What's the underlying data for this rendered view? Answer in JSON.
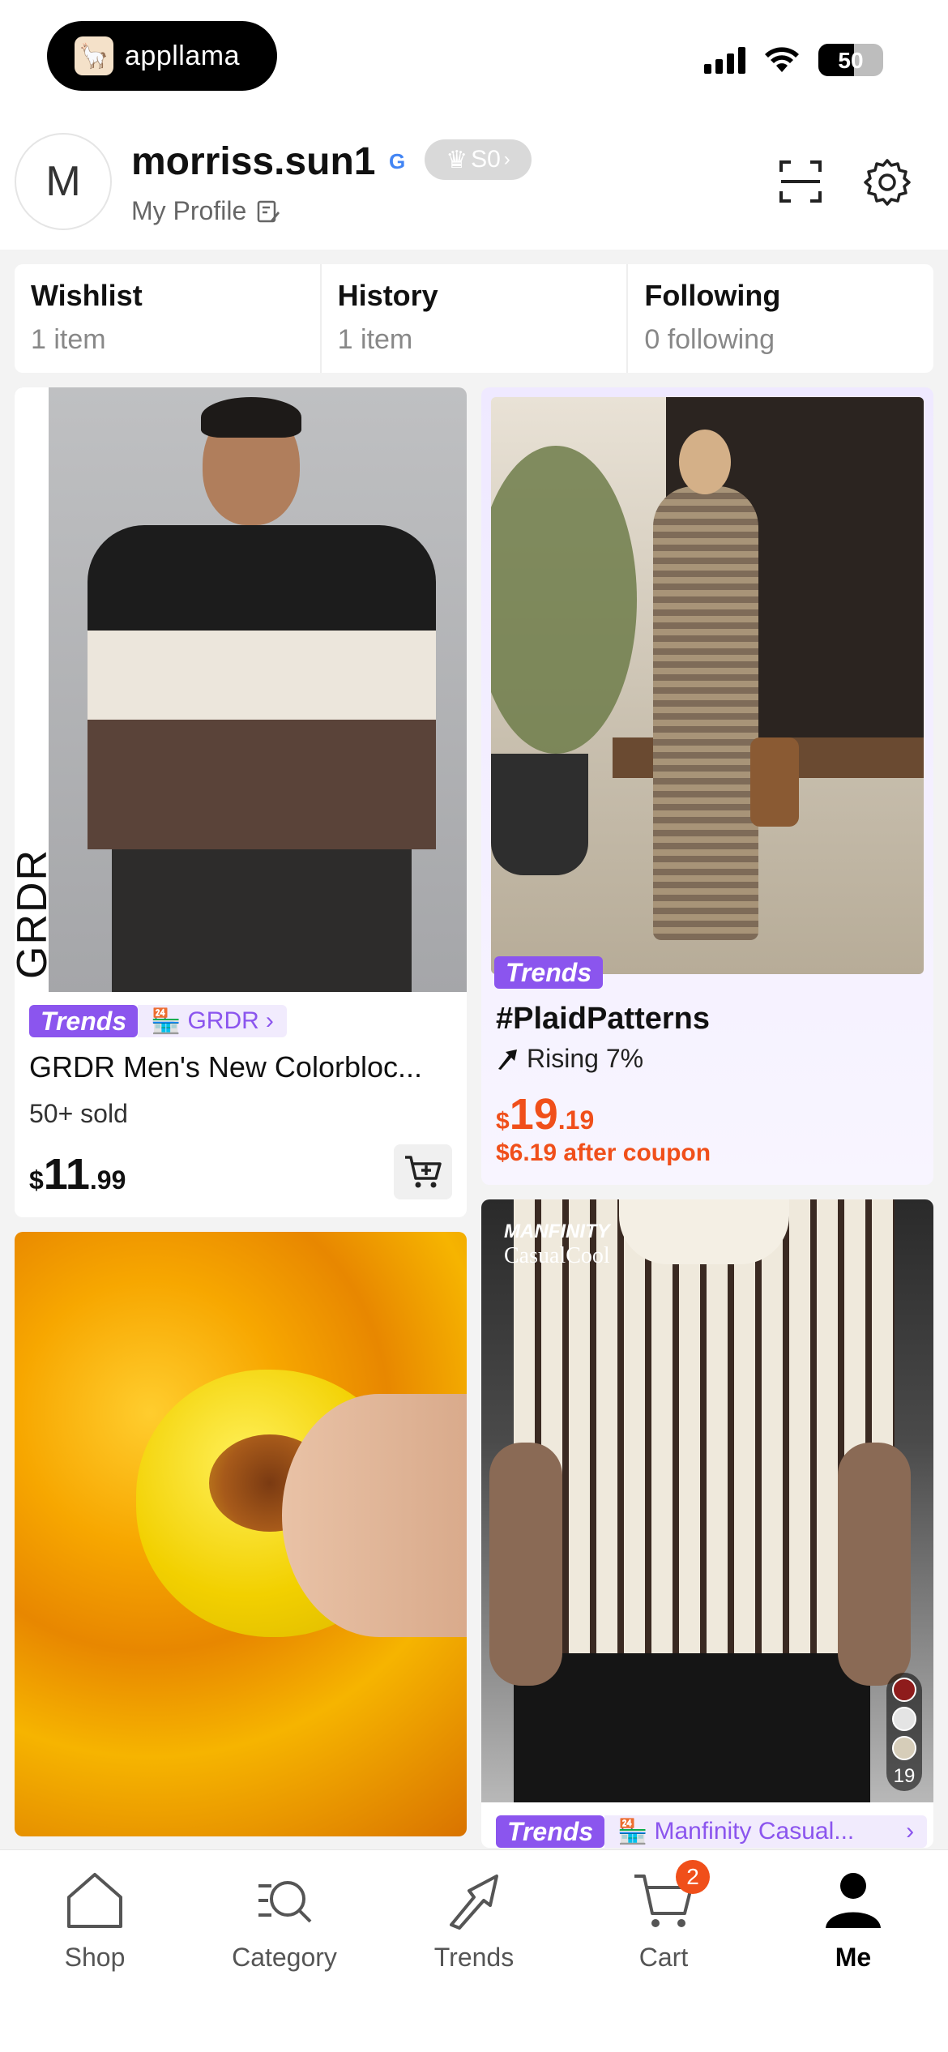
{
  "status_bar": {
    "app_name": "appllama",
    "battery": "50"
  },
  "profile": {
    "avatar_initial": "M",
    "username": "morriss.sun1",
    "provider_icon": "G",
    "vip_level": "S0",
    "my_profile_label": "My Profile"
  },
  "stats": [
    {
      "title": "Wishlist",
      "sub": "1 item"
    },
    {
      "title": "History",
      "sub": "1 item"
    },
    {
      "title": "Following",
      "sub": "0 following"
    }
  ],
  "feed": {
    "card1": {
      "brand_overlay": "GRDR",
      "trend_badge": "Trends",
      "store": "GRDR",
      "title": "GRDR Men's New Colorbloc...",
      "sold": "50+ sold",
      "price_currency": "$",
      "price_main": "11",
      "price_cents": ".99"
    },
    "card2": {
      "trend_badge": "Trends",
      "hashtag": "#PlaidPatterns",
      "rising": "Rising 7%",
      "price_currency": "$",
      "price_main": "19",
      "price_cents": ".19",
      "coupon": "$6.19 after coupon"
    },
    "card4": {
      "brand_line1": "MANFINITY",
      "brand_line2": "CasualCool",
      "swatch_count": "19",
      "trend_badge": "Trends",
      "store": "Manfinity Casual..."
    }
  },
  "tabs": [
    {
      "label": "Shop",
      "icon": "home-icon"
    },
    {
      "label": "Category",
      "icon": "category-search-icon"
    },
    {
      "label": "Trends",
      "icon": "trends-arrow-icon"
    },
    {
      "label": "Cart",
      "icon": "cart-icon",
      "badge": "2"
    },
    {
      "label": "Me",
      "icon": "person-icon",
      "active": true
    }
  ],
  "colors": {
    "accent_purple": "#8b55ee",
    "price_orange": "#f04f1a"
  }
}
